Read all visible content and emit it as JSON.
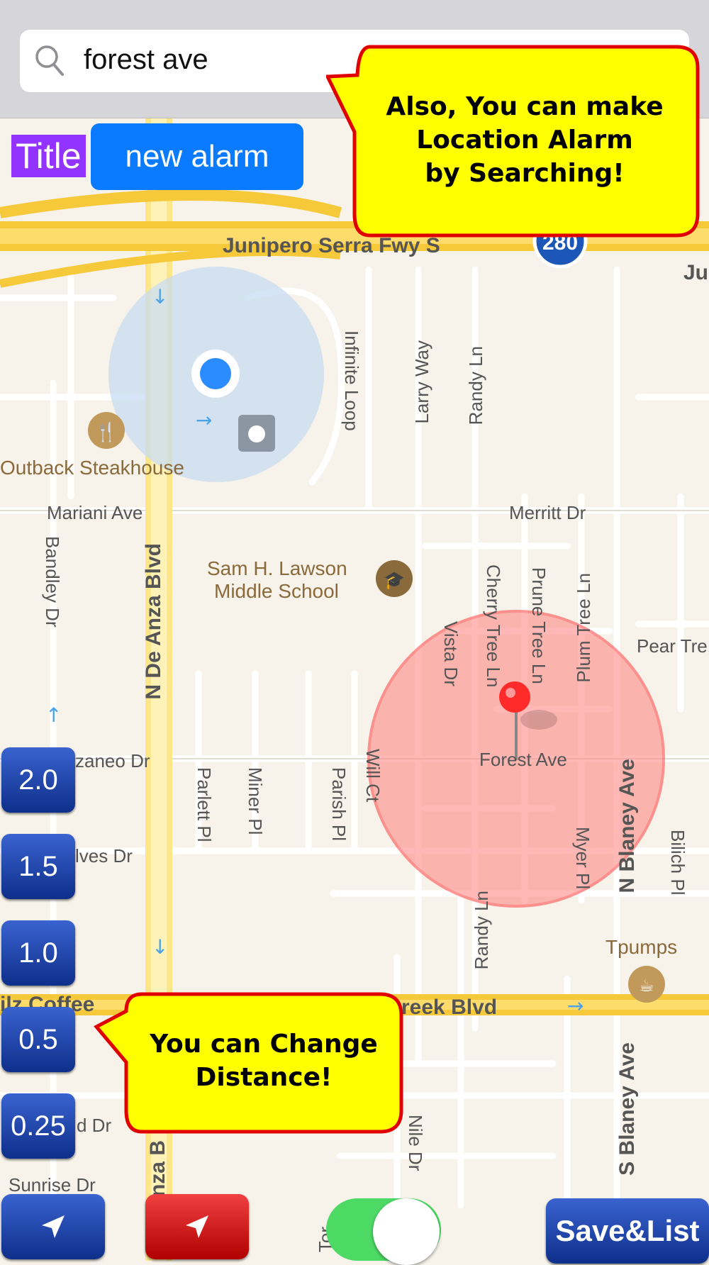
{
  "search": {
    "query": "forest ave"
  },
  "title_badge": "Title",
  "new_alarm_label": "new alarm",
  "callouts": {
    "top": "Also, You can make\nLocation Alarm\nby Searching!",
    "bottom": "You can Change\nDistance!"
  },
  "distance_buttons": [
    "2.0",
    "1.5",
    "1.0",
    "0.5",
    "0.25"
  ],
  "save_list_label": "Save&List",
  "toggle_on": true,
  "map": {
    "highway_shield": "280",
    "labels": {
      "junipero": "Junipero Serra Fwy S",
      "jun_edge": "Ju",
      "outback": "Outback Steakhouse",
      "mariani": "Mariani Ave",
      "merritt": "Merritt Dr",
      "lawson1": "Sam H. Lawson",
      "lawson2": "Middle School",
      "infinite": "Infinite Loop",
      "larry": "Larry Way",
      "randy_top": "Randy Ln",
      "bandley": "Bandley Dr",
      "de_anza": "N De Anza Blvd",
      "cherry": "Cherry Tree Ln",
      "prune": "Prune Tree Ln",
      "plum": "Plum Tree Ln",
      "vista": "Vista Dr",
      "pear": "Pear Tre",
      "forest": "Forest Ave",
      "zaneo": "zaneo Dr",
      "parlett": "Parlett Pl",
      "miner": "Miner Pl",
      "parish": "Parish Pl",
      "will": "Will Ct",
      "alves": "lves Dr",
      "n_blaney": "N Blaney Ave",
      "myer": "Myer Pl",
      "bilich": "Bilich Pl",
      "randy_bottom": "Randy Ln",
      "tpumps": "Tpumps",
      "ilz": "ilz Coffee",
      "creek": "reek Blvd",
      "s_blaney": "S Blaney Ave",
      "nile": "Nile Dr",
      "d_dr": "d Dr",
      "anza_b": "nza B",
      "sunrise": "Sunrise Dr",
      "tor": "Tor"
    }
  },
  "colors": {
    "accent_blue": "#0a7aff",
    "title_purple": "#9333ff",
    "callout_yellow": "#ffff00",
    "callout_border": "#e00000",
    "radius_red": "#ff5050",
    "toggle_green": "#4cd964"
  }
}
